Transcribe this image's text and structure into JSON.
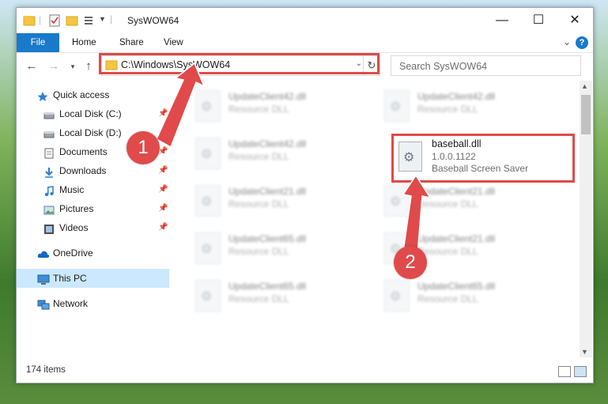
{
  "window": {
    "title": "SysWOW64",
    "controls": {
      "minimize": "—",
      "maximize": "☐",
      "close": "✕"
    }
  },
  "ribbon": {
    "tabs": [
      {
        "label": "File"
      },
      {
        "label": "Home"
      },
      {
        "label": "Share"
      },
      {
        "label": "View"
      }
    ],
    "help": "?"
  },
  "address_bar": {
    "path": "C:\\Windows\\SysWOW64",
    "search_placeholder": "Search SysWOW64"
  },
  "sidebar": {
    "items": [
      {
        "label": "Quick access",
        "icon": "star-icon",
        "pinned": false
      },
      {
        "label": "Local Disk (C:)",
        "icon": "drive-icon",
        "pinned": true
      },
      {
        "label": "Local Disk (D:)",
        "icon": "drive-icon",
        "pinned": true
      },
      {
        "label": "Documents",
        "icon": "document-icon",
        "pinned": true
      },
      {
        "label": "Downloads",
        "icon": "download-icon",
        "pinned": true
      },
      {
        "label": "Music",
        "icon": "music-icon",
        "pinned": true
      },
      {
        "label": "Pictures",
        "icon": "pictures-icon",
        "pinned": true
      },
      {
        "label": "Videos",
        "icon": "video-icon",
        "pinned": true
      },
      {
        "label": "OneDrive",
        "icon": "cloud-icon",
        "pinned": false
      },
      {
        "label": "This PC",
        "icon": "computer-icon",
        "pinned": false,
        "selected": true
      },
      {
        "label": "Network",
        "icon": "network-icon",
        "pinned": false
      }
    ]
  },
  "files": [
    {
      "name": "UpdateClient42.dll",
      "desc": "Resource DLL"
    },
    {
      "name": "UpdateClient42.dll",
      "desc": "Resource DLL"
    },
    {
      "name": "UpdateClient42.dll",
      "desc": "Resource DLL"
    },
    {
      "name": "UpdateClient21.dll",
      "desc": "Resource DLL"
    },
    {
      "name": "UpdateClient21.dll",
      "desc": "Resource DLL"
    },
    {
      "name": "UpdateClient65.dll",
      "desc": "Resource DLL"
    },
    {
      "name": "UpdateClient21.dll",
      "desc": "Resource DLL"
    },
    {
      "name": "UpdateClient65.dll",
      "desc": "Resource DLL"
    },
    {
      "name": "UpdateClient65.dll",
      "desc": "Resource DLL"
    }
  ],
  "selected_file": {
    "name": "baseball.dll",
    "version": "1.0.0.1122",
    "description": "Baseball Screen Saver"
  },
  "status": {
    "item_count": "174 items"
  },
  "annotations": {
    "step1": "1",
    "step2": "2"
  },
  "colors": {
    "accent": "#1979ca",
    "annotation": "#e04a4a",
    "selection": "#cce8ff"
  }
}
